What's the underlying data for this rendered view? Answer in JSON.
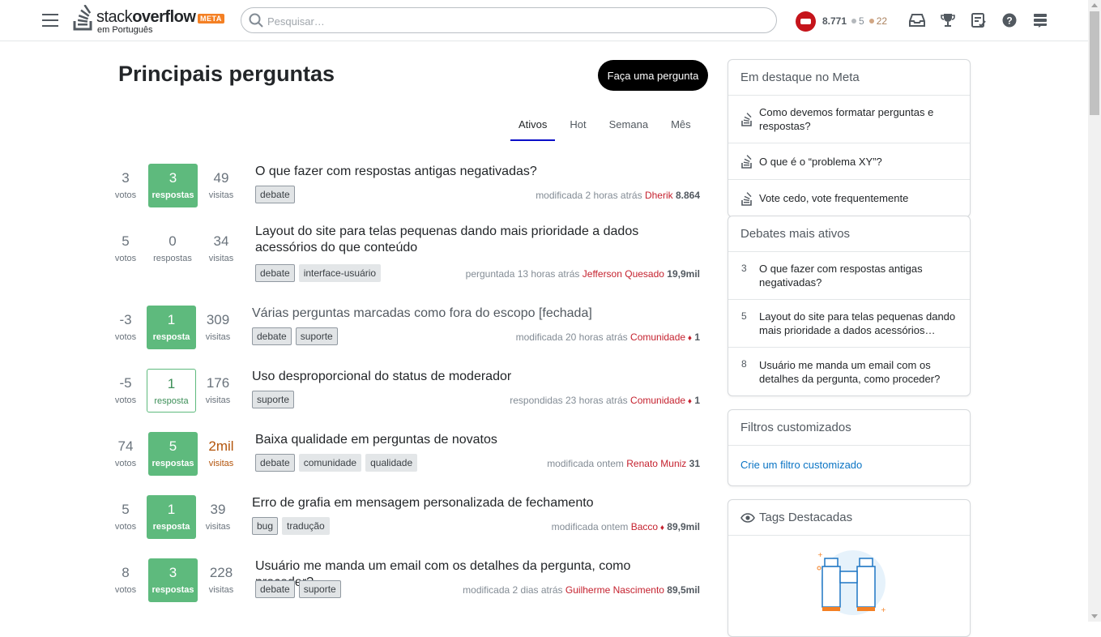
{
  "header": {
    "logo_stack": "stack",
    "logo_overflow": "overflow",
    "logo_badge": "META",
    "logo_sub": "em Português",
    "search_placeholder": "Pesquisar…",
    "reputation": "8.771",
    "silver_badges": "5",
    "bronze_badges": "22",
    "icons": [
      "inbox-icon",
      "trophy-icon",
      "review-icon",
      "help-icon",
      "site-switcher-icon"
    ]
  },
  "main": {
    "title": "Principais perguntas",
    "ask_button": "Faça uma pergunta",
    "tabs": [
      {
        "label": "Ativos",
        "active": true
      },
      {
        "label": "Hot",
        "active": false
      },
      {
        "label": "Semana",
        "active": false
      },
      {
        "label": "Mês",
        "active": false
      }
    ]
  },
  "questions": [
    {
      "votes": "3",
      "votes_label": "votos",
      "answers": "3",
      "answers_label": "respostas",
      "answer_state": "full",
      "views": "49",
      "views_label": "visitas",
      "views_hot": false,
      "title": "O que fazer com respostas antigas negativadas?",
      "closed": false,
      "tags": [
        "debate"
      ],
      "action": "modificada 2 horas atrás",
      "user": "Dherik",
      "mod": false,
      "rep": "8.864"
    },
    {
      "votes": "5",
      "votes_label": "votos",
      "answers": "0",
      "answers_label": "respostas",
      "answer_state": "none",
      "views": "34",
      "views_label": "visitas",
      "views_hot": false,
      "title": "Layout do site para telas pequenas dando mais prioridade a dados acessórios do que conteúdo",
      "closed": false,
      "tags": [
        "debate",
        "interface-usuário"
      ],
      "action": "perguntada 13 horas atrás",
      "user": "Jefferson Quesado",
      "mod": false,
      "rep": "19,9mil"
    },
    {
      "votes": "-3",
      "votes_label": "votos",
      "answers": "1",
      "answers_label": "resposta",
      "answer_state": "full",
      "views": "309",
      "views_label": "visitas",
      "views_hot": false,
      "title": "Várias perguntas marcadas como fora do escopo [fechada]",
      "closed": true,
      "tags": [
        "debate",
        "suporte"
      ],
      "action": "modificada 20 horas atrás",
      "user": "Comunidade",
      "mod": true,
      "rep": "1"
    },
    {
      "votes": "-5",
      "votes_label": "votos",
      "answers": "1",
      "answers_label": "resposta",
      "answer_state": "outline",
      "views": "176",
      "views_label": "visitas",
      "views_hot": false,
      "title": "Uso desproporcional do status de moderador",
      "closed": false,
      "tags": [
        "suporte"
      ],
      "action": "respondidas 23 horas atrás",
      "user": "Comunidade",
      "mod": true,
      "rep": "1"
    },
    {
      "votes": "74",
      "votes_label": "votos",
      "answers": "5",
      "answers_label": "respostas",
      "answer_state": "full",
      "views": "2mil",
      "views_label": "visitas",
      "views_hot": true,
      "title": "Baixa qualidade em perguntas de novatos",
      "closed": false,
      "tags": [
        "debate",
        "comunidade",
        "qualidade"
      ],
      "action": "modificada ontem",
      "user": "Renato Muniz",
      "mod": false,
      "rep": "31"
    },
    {
      "votes": "5",
      "votes_label": "votos",
      "answers": "1",
      "answers_label": "resposta",
      "answer_state": "full",
      "views": "39",
      "views_label": "visitas",
      "views_hot": false,
      "title": "Erro de grafia em mensagem personalizada de fechamento",
      "closed": false,
      "tags": [
        "bug",
        "tradução"
      ],
      "action": "modificada ontem",
      "user": "Bacco",
      "mod": true,
      "rep": "89,9mil"
    },
    {
      "votes": "8",
      "votes_label": "votos",
      "answers": "3",
      "answers_label": "respostas",
      "answer_state": "full",
      "views": "228",
      "views_label": "visitas",
      "views_hot": false,
      "title": "Usuário me manda um email com os detalhes da pergunta, como proceder?",
      "closed": false,
      "tags": [
        "debate",
        "suporte"
      ],
      "action": "modificada 2 dias atrás",
      "user": "Guilherme Nascimento",
      "mod": false,
      "rep": "89,5mil"
    }
  ],
  "sidebar": {
    "featured_title": "Em destaque no Meta",
    "featured_items": [
      "Como devemos formatar perguntas e respostas?",
      "O que é o “problema XY”?",
      "Vote cedo, vote frequentemente"
    ],
    "hot_title": "Debates mais ativos",
    "hot_items": [
      {
        "count": "3",
        "title": "O que fazer com respostas antigas negativadas?"
      },
      {
        "count": "5",
        "title": "Layout do site para telas pequenas dando mais prioridade a dados acessórios…"
      },
      {
        "count": "8",
        "title": "Usuário me manda um email com os detalhes da pergunta, como proceder?"
      }
    ],
    "filters_title": "Filtros customizados",
    "filters_link": "Crie um filtro customizado",
    "tags_title": "Tags Destacadas"
  },
  "colors": {
    "answered": "#5eba7d",
    "hot_views": "#b3540b",
    "user_link": "#c5222f",
    "tab_active": "#0a0ec9",
    "meta_badge": "#f48024"
  }
}
